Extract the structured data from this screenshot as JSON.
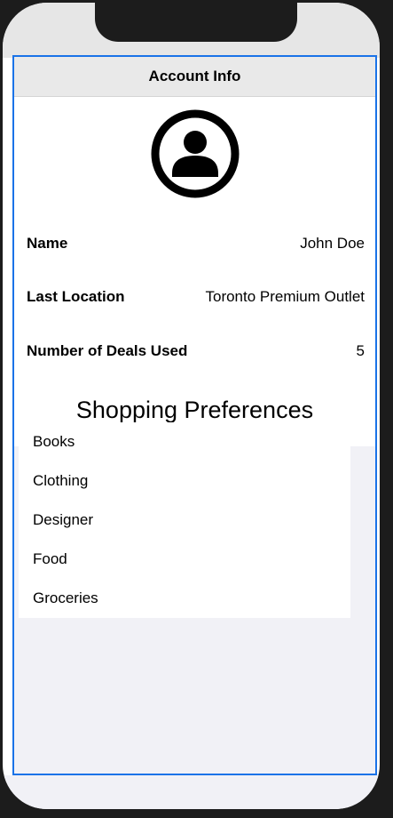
{
  "nav": {
    "title": "Account Info"
  },
  "profile": {
    "avatar_icon": "person-circle-icon",
    "name_label": "Name",
    "name_value": "John Doe",
    "location_label": "Last Location",
    "location_value": "Toronto Premium Outlet",
    "deals_label": "Number of Deals Used",
    "deals_value": "5"
  },
  "preferences": {
    "heading": "Shopping Preferences",
    "items": [
      "Books",
      "Clothing",
      "Designer",
      "Food",
      "Groceries"
    ]
  },
  "colors": {
    "frame_border": "#1a73e8",
    "background_grouped": "#f1f1f6",
    "nav_background": "#e9e9e9"
  }
}
